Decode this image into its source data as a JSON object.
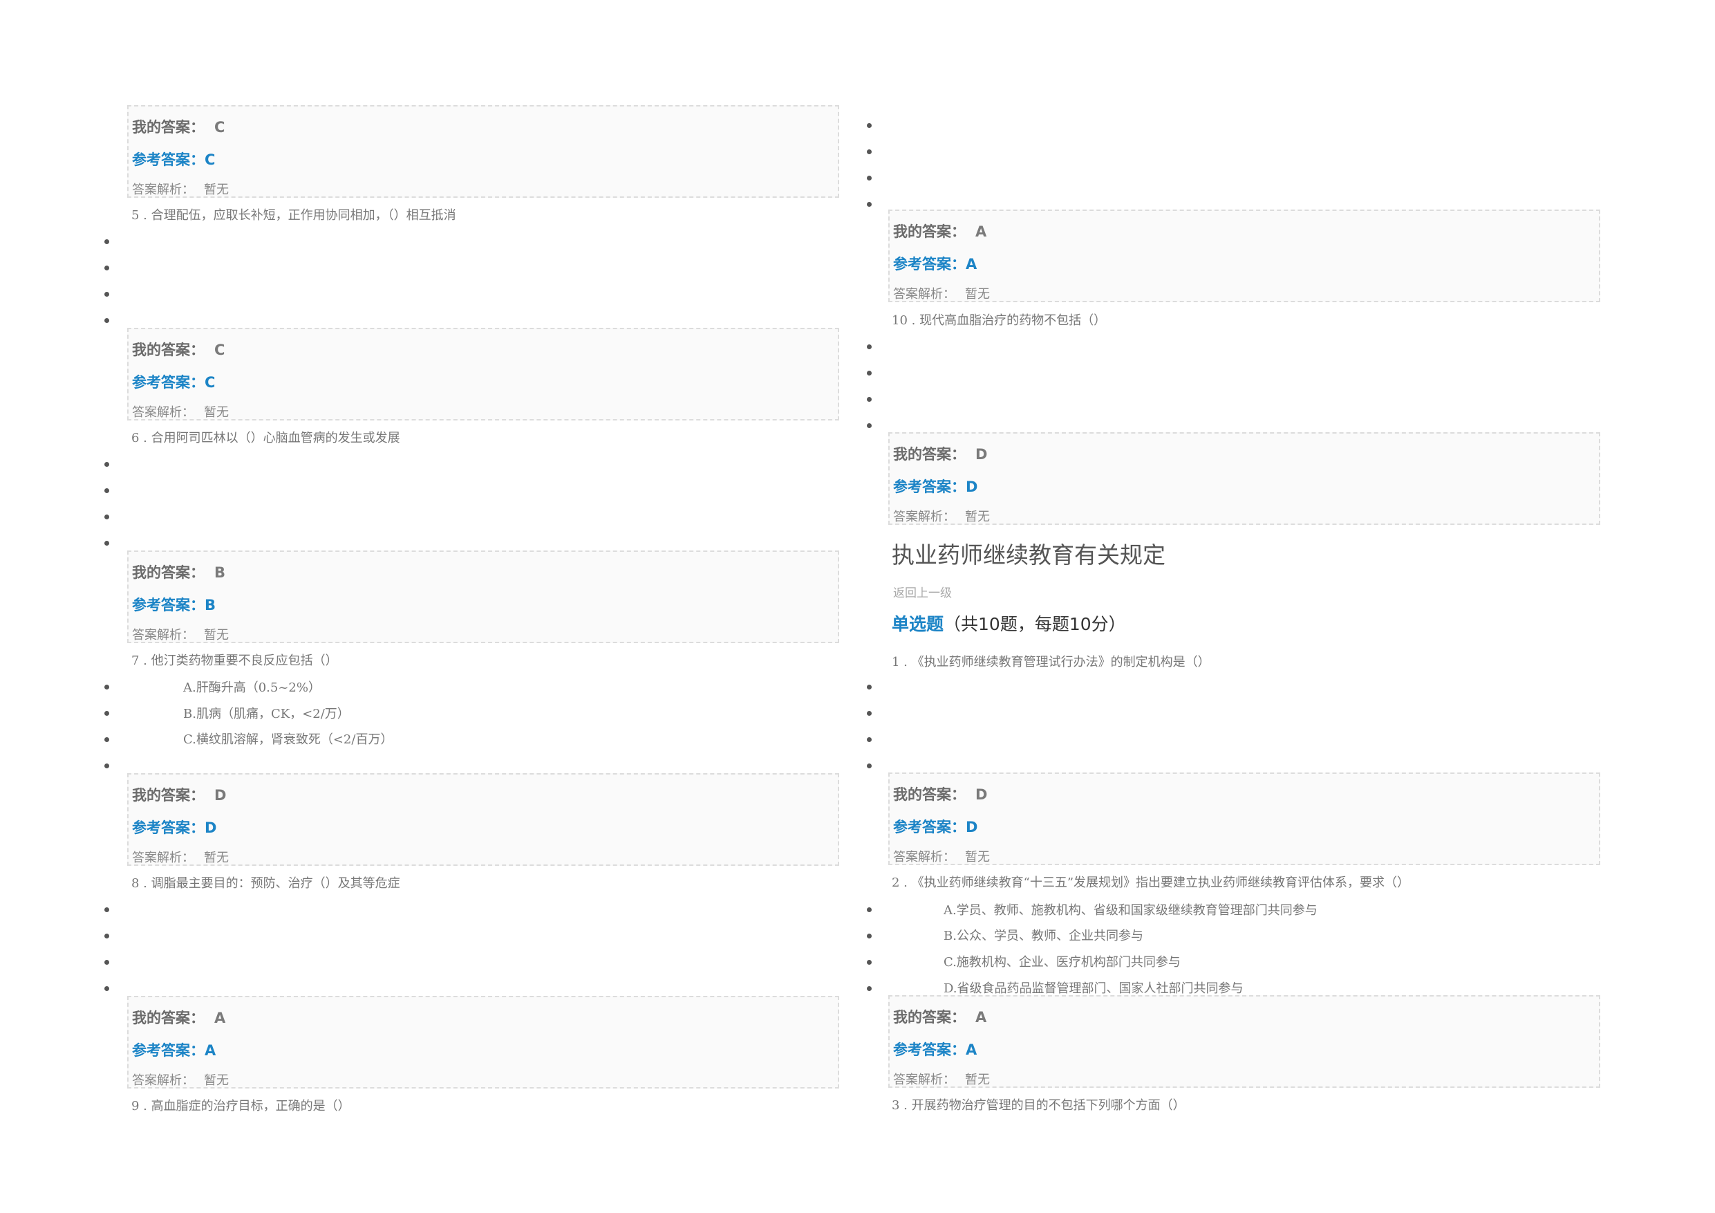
{
  "labels": {
    "my_answer": "我的答案：",
    "ref_answer": "参考答案：",
    "explanation": "答案解析：",
    "explanation_value": "暂无"
  },
  "left": {
    "blocks": [
      {
        "my": "C",
        "ref": "C"
      },
      {
        "my": "C",
        "ref": "C"
      },
      {
        "my": "B",
        "ref": "B"
      },
      {
        "my": "D",
        "ref": "D"
      },
      {
        "my": "A",
        "ref": "A"
      }
    ],
    "questions": [
      {
        "text": "5 . 合理配伍，应取长补短，正作用协同相加，（）相互抵消"
      },
      {
        "text": "6 . 合用阿司匹林以（）心脑血管病的发生或发展"
      },
      {
        "text": "7 . 他汀类药物重要不良反应包括（）"
      },
      {
        "text": "8 . 调脂最主要目的：预防、治疗（）及其等危症"
      },
      {
        "text": "9 . 高血脂症的治疗目标，正确的是（）"
      }
    ],
    "q7_options": [
      "A.肝酶升高（0.5~2%）",
      "B.肌病（肌痛，CK，<2/万）",
      "C.横纹肌溶解，肾衰致死（<2/百万）"
    ]
  },
  "right": {
    "blocks": [
      {
        "my": "A",
        "ref": "A"
      },
      {
        "my": "D",
        "ref": "D"
      },
      {
        "my": "D",
        "ref": "D"
      },
      {
        "my": "A",
        "ref": "A"
      }
    ],
    "questions": [
      {
        "text": "10 . 现代高血脂治疗的药物不包括（）"
      },
      {
        "text": "1 . 《执业药师继续教育管理试行办法》的制定机构是（）"
      },
      {
        "text": "2 . 《执业药师继续教育“十三五”发展规划》指出要建立执业药师继续教育评估体系，要求（）"
      },
      {
        "text": "3 . 开展药物治疗管理的目的不包括下列哪个方面（）"
      }
    ],
    "section_title": "执业药师继续教育有关规定",
    "back_link": "返回上一级",
    "type_heading": {
      "bold": "单选题",
      "rest": "（共10题，每题10分）"
    },
    "q2_options": [
      "A.学员、教师、施教机构、省级和国家级继续教育管理部门共同参与",
      "B.公众、学员、教师、企业共同参与",
      "C.施教机构、企业、医疗机构部门共同参与",
      "D.省级食品药品监督管理部门、国家人社部门共同参与"
    ]
  }
}
